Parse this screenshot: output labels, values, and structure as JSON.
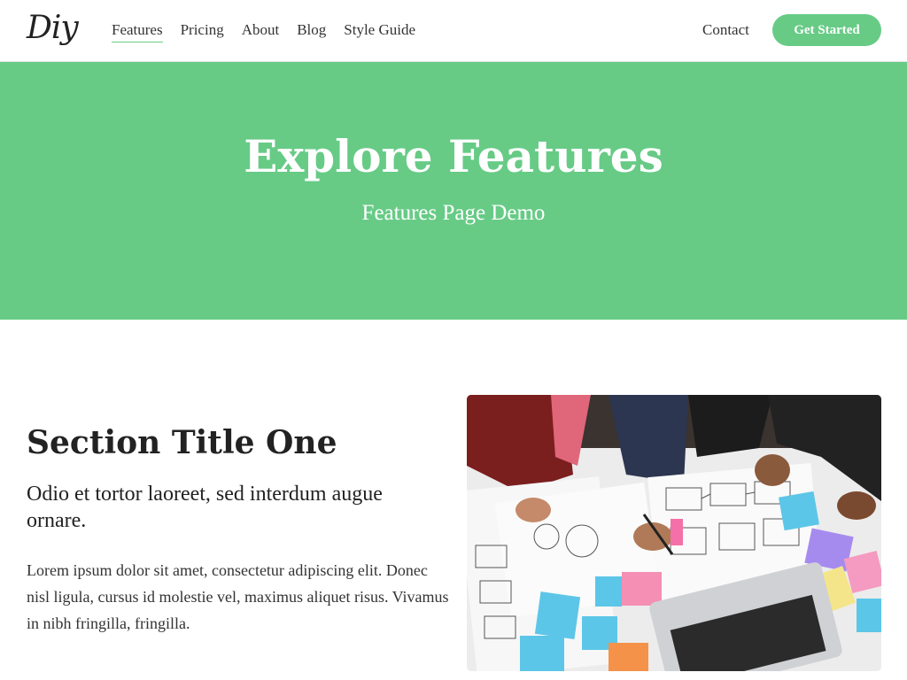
{
  "nav": {
    "logo": "Diy",
    "links": [
      {
        "label": "Features",
        "active": true
      },
      {
        "label": "Pricing",
        "active": false
      },
      {
        "label": "About",
        "active": false
      },
      {
        "label": "Blog",
        "active": false
      },
      {
        "label": "Style Guide",
        "active": false
      }
    ],
    "contact": "Contact",
    "cta": "Get Started"
  },
  "hero": {
    "title": "Explore Features",
    "subtitle": "Features Page Demo",
    "bg_color": "#67cb86"
  },
  "section": {
    "title": "Section Title One",
    "lead": "Odio et tortor laoreet, sed interdum augue ornare.",
    "body": "Lorem ipsum dolor sit amet, consectetur adipiscing elit. Donec nisl ligula, cursus id molestie vel, maximus aliquet risus. Vivamus in nibh fringilla, fringilla.",
    "image_subject": "team-planning-wireframes-photo"
  },
  "colors": {
    "accent": "#67cb86",
    "text": "#222222"
  }
}
